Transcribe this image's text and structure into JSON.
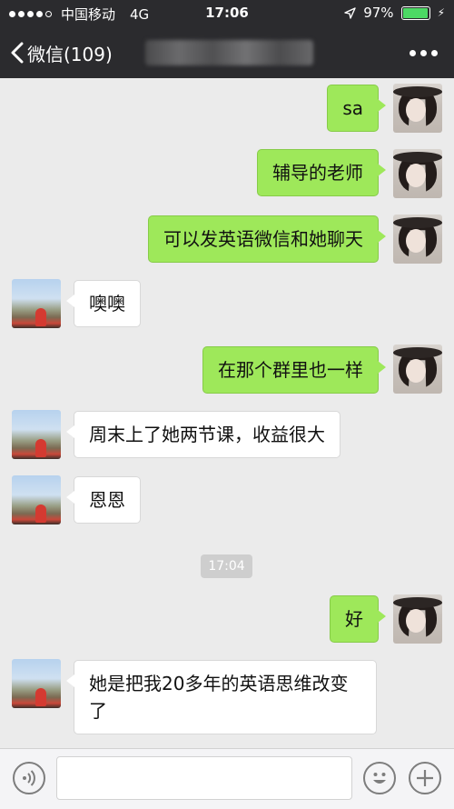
{
  "status_bar": {
    "carrier": "中国移动",
    "network": "4G",
    "time": "17:06",
    "battery": "97%"
  },
  "nav": {
    "back_label": "微信(109)"
  },
  "messages": [
    {
      "from": "me",
      "text": "sa"
    },
    {
      "from": "me",
      "text": "辅导的老师"
    },
    {
      "from": "me",
      "text": "可以发英语微信和她聊天"
    },
    {
      "from": "them",
      "text": "噢噢"
    },
    {
      "from": "me",
      "text": "在那个群里也一样"
    },
    {
      "from": "them",
      "text": "周末上了她两节课，收益很大"
    },
    {
      "from": "them",
      "text": "恩恩"
    },
    {
      "from": "me",
      "text": "好"
    },
    {
      "from": "them",
      "text": "她是把我20多年的英语思维改变了"
    }
  ],
  "timestamp": "17:04",
  "icons": {
    "back": "chevron-left-icon",
    "more": "more-dots-icon",
    "voice": "voice-icon",
    "emoji": "emoji-icon",
    "plus": "plus-icon",
    "location": "location-arrow-icon",
    "charging": "charging-bolt-icon"
  },
  "colors": {
    "bar_background": "#2b2b2e",
    "my_bubble": "#9ee85a",
    "their_bubble": "#ffffff",
    "chat_background": "#ebebeb",
    "battery": "#4cd964"
  }
}
